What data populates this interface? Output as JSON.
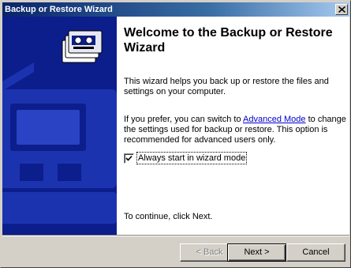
{
  "window": {
    "title": "Backup or Restore Wizard"
  },
  "wizard": {
    "heading": "Welcome to the Backup or Restore Wizard",
    "intro": "This wizard helps you back up or restore the files and settings on your computer.",
    "advanced_prefix": "If you prefer, you can switch to ",
    "advanced_link": "Advanced Mode",
    "advanced_suffix": " to change the settings used for backup or restore. This option is recommended for advanced users only.",
    "checkbox_label": "Always start in wizard mode",
    "checkbox_checked": true,
    "continue_text": "To continue, click Next."
  },
  "buttons": {
    "back": "< Back",
    "next": "Next >",
    "cancel": "Cancel"
  },
  "colors": {
    "left_panel": "#0c1e8c",
    "titlebar_start": "#0a246a",
    "link": "#0000cc"
  },
  "icons": {
    "wizard_graphic": "backup-tape-icon",
    "close": "close-icon"
  }
}
